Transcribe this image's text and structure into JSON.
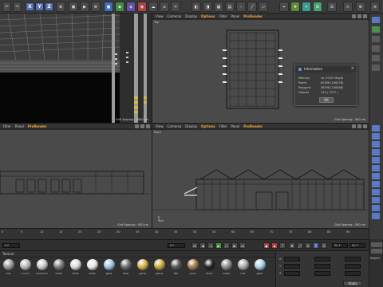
{
  "toolbar": {
    "axis_buttons": [
      "X",
      "Y",
      "Z"
    ]
  },
  "viewports": {
    "top_left": {
      "menu": [
        "Filter",
        "Panel",
        "ProRender"
      ],
      "active": "ProRender",
      "grid_spacing": "Grid Spacing : 5000 cm"
    },
    "top_right": {
      "menu": [
        "View",
        "Cameras",
        "Display",
        "Options",
        "Filter",
        "Panel",
        "ProRender"
      ],
      "active": "ProRender",
      "label": "Top",
      "grid_spacing": "Grid Spacing : 500 cm"
    },
    "bottom_left": {
      "menu": [
        "Filter",
        "Panel",
        "ProRender"
      ],
      "active": "ProRender"
    },
    "bottom_right": {
      "menu": [
        "View",
        "Cameras",
        "Display",
        "Options",
        "Filter",
        "Panel",
        "ProRender"
      ],
      "active": "ProRender",
      "label": "Front",
      "grid_spacing": "Grid Spacing : 500 cm"
    },
    "bottom_left_grid_spacing": "Grid Spacing : 500 cm"
  },
  "info_dialog": {
    "title": "Information",
    "close": "×",
    "rows": [
      {
        "label": "Memory",
        "value": "ca. 93.07 Mbyte"
      },
      {
        "label": "Points",
        "value": "60596 (196278)"
      },
      {
        "label": "Polygons",
        "value": "56798 (148288)"
      },
      {
        "label": "Objects",
        "value": "315 ( 1077 )"
      }
    ],
    "ok_label": "OK"
  },
  "timeline": {
    "ticks": [
      "0",
      "5",
      "10",
      "15",
      "20",
      "25",
      "30",
      "35",
      "40",
      "45",
      "50",
      "55",
      "60",
      "65",
      "70",
      "75",
      "80",
      "85",
      "90"
    ]
  },
  "transport": {
    "frame_start": "0 F",
    "frame_current": "0 F",
    "frame_end": "90 F",
    "frame_max": "90 F"
  },
  "materials": {
    "menu": [
      "Texture"
    ],
    "items": [
      {
        "label": "mat",
        "color": "#9a9a9a"
      },
      {
        "label": "concre",
        "color": "#b8b8b8"
      },
      {
        "label": "aluminum",
        "color": "#c9c9c9"
      },
      {
        "label": "metal",
        "color": "#7c7c7c"
      },
      {
        "label": "white",
        "color": "#dcdcdc"
      },
      {
        "label": "white",
        "color": "#e6e6e6"
      },
      {
        "label": "glass",
        "color": "#9fc4e0"
      },
      {
        "label": "steel",
        "color": "#6c6c6c"
      },
      {
        "label": "yellow",
        "color": "#d3b04a"
      },
      {
        "label": "yellow",
        "color": "#c9a53c"
      },
      {
        "label": "Mat",
        "color": "#585858"
      },
      {
        "label": "wood",
        "color": "#a37b4f"
      },
      {
        "label": "black",
        "color": "#222222"
      },
      {
        "label": "metal",
        "color": "#8d8d8d"
      },
      {
        "label": "mat",
        "color": "#a8a8a8"
      },
      {
        "label": "glass",
        "color": "#a9d0ea"
      }
    ]
  },
  "attributes": {
    "apply_label": "Apply",
    "row_labels": [
      "X",
      "Y",
      "Z"
    ]
  },
  "side_panel": {
    "label": "Project"
  },
  "colors": {
    "accent": "#f0a53a",
    "viewport_bg": "#4a4a4a",
    "axis_blue": "#5872b8"
  }
}
